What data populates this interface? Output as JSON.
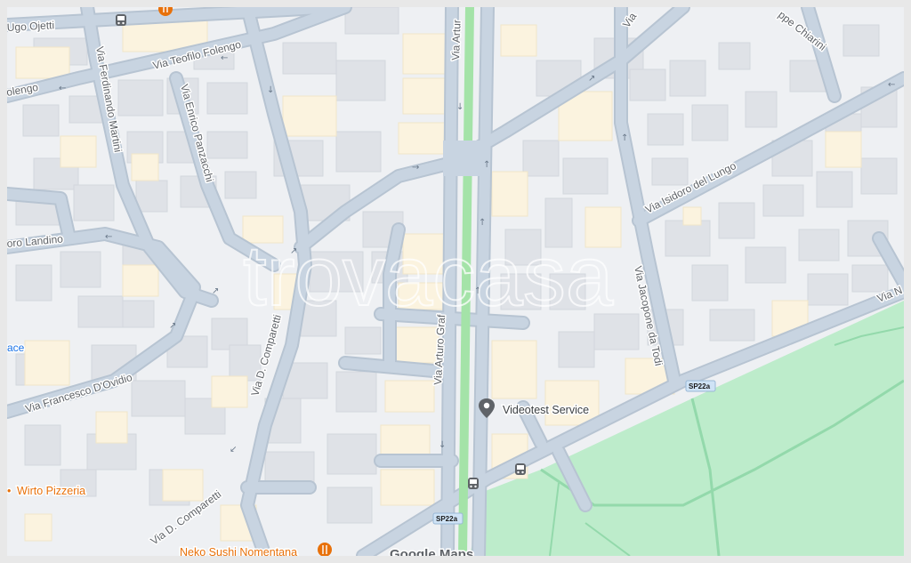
{
  "watermark": "trovacasa",
  "attribution": "Google Maps",
  "streets": {
    "ugo_ojetti": "Ugo Ojetti",
    "teofilo_folengo": "Via Teofilo Folengo",
    "folengo_left": "olengo",
    "ferdinando_martini": "Via Ferdinando Martini",
    "enrico_panzacchi": "Via Enrico Panzacchi",
    "arturo_graf_top": "Via Artur",
    "arturo_graf": "Via Arturo Graf",
    "chiarini": "ppe Chiarini",
    "via_top": "Via",
    "isidoro_del_lungo": "Via Isidoro del Lungo",
    "landino": "oro Landino",
    "jacopone": "Via Jacopone da Todi",
    "via_n": "Via N",
    "comparetti_upper": "Via D. Comparetti",
    "comparetti_lower": "Via D. Comparetti",
    "francesco_dovidio": "Via Francesco D'Ovidio",
    "ace": "ace"
  },
  "road_shields": {
    "upper": "SP22a",
    "lower": "SP22a"
  },
  "pois": {
    "videotest": "Videotest Service",
    "wirto": "Wirto Pizzeria",
    "neko": "Neko Sushi Nomentana"
  },
  "colors": {
    "land": "#eef0f3",
    "building": "#dfe2e7",
    "building_beige": "#fbf3df",
    "road": "#c3d0dd",
    "road_edge": "#b7c4d2",
    "park": "#bdeccb",
    "park_path": "#93d9ab",
    "median": "#a4e3a8",
    "label": "#5f6368",
    "poi_grey": "#5f6368",
    "poi_orange": "#e8710a",
    "shield": "#cfe3f6"
  },
  "icons": {
    "marker": "map-pin-icon",
    "restaurant": "fork-knife-icon",
    "bus": "bus-stop-icon",
    "arrow": "one-way-arrow-icon"
  }
}
